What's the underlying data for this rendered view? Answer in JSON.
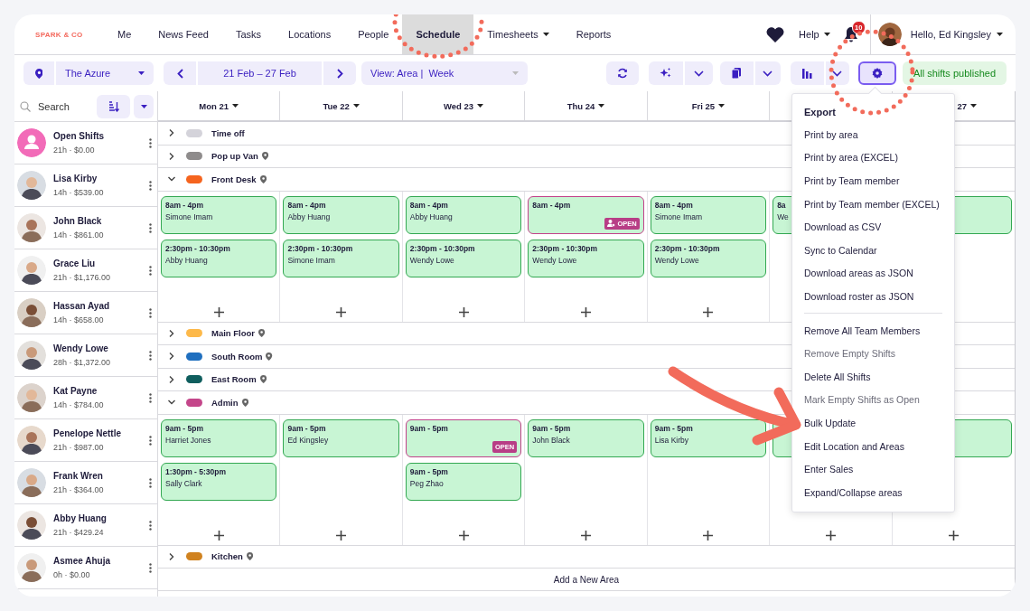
{
  "nav": {
    "logo": "SPARK & CO",
    "items": [
      {
        "label": "Me",
        "selected": false,
        "dropdown": false
      },
      {
        "label": "News Feed",
        "selected": false,
        "dropdown": false
      },
      {
        "label": "Tasks",
        "selected": false,
        "dropdown": false
      },
      {
        "label": "Locations",
        "selected": false,
        "dropdown": false
      },
      {
        "label": "People",
        "selected": false,
        "dropdown": false
      },
      {
        "label": "Schedule",
        "selected": true,
        "dropdown": false
      },
      {
        "label": "Timesheets",
        "selected": false,
        "dropdown": true
      },
      {
        "label": "Reports",
        "selected": false,
        "dropdown": false
      }
    ],
    "help": "Help",
    "notifications": "10",
    "greeting": "Hello, Ed Kingsley"
  },
  "toolbar": {
    "location": "The Azure",
    "date_range": "21 Feb – 27 Feb",
    "view": "View: Area |  Week",
    "status": "All shifts published"
  },
  "sidebar": {
    "search": {
      "placeholder": "Search"
    },
    "people": [
      {
        "name": "Open Shifts",
        "stats": "21h · $0.00",
        "kind": "open"
      },
      {
        "name": "Lisa Kirby",
        "stats": "14h · $539.00",
        "kind": "person"
      },
      {
        "name": "John Black",
        "stats": "14h · $861.00",
        "kind": "person"
      },
      {
        "name": "Grace Liu",
        "stats": "21h · $1,176.00",
        "kind": "person"
      },
      {
        "name": "Hassan Ayad",
        "stats": "14h · $658.00",
        "kind": "person"
      },
      {
        "name": "Wendy Lowe",
        "stats": "28h · $1,372.00",
        "kind": "person"
      },
      {
        "name": "Kat Payne",
        "stats": "14h · $784.00",
        "kind": "person"
      },
      {
        "name": "Penelope Nettle",
        "stats": "21h · $987.00",
        "kind": "person"
      },
      {
        "name": "Frank Wren",
        "stats": "21h · $364.00",
        "kind": "person"
      },
      {
        "name": "Abby Huang",
        "stats": "21h · $429.24",
        "kind": "person"
      },
      {
        "name": "Asmee Ahuja",
        "stats": "0h · $0.00",
        "kind": "person"
      }
    ]
  },
  "days": [
    "Mon 21",
    "Tue 22",
    "Wed 23",
    "Thu 24",
    "Fri 25"
  ],
  "last_day_partial": "27",
  "areas": [
    {
      "name": "Time off",
      "color": "#d4d3da",
      "expanded": false,
      "location_icon": false
    },
    {
      "name": "Pop up Van",
      "color": "#8f8c8c",
      "expanded": false,
      "location_icon": true
    },
    {
      "name": "Front Desk",
      "color": "#f5641e",
      "expanded": true,
      "location_icon": true,
      "days": [
        {
          "add_button": true,
          "shifts": [
            {
              "time": "8am - 4pm",
              "name": "Simone Imam",
              "open": false
            },
            {
              "time": "2:30pm - 10:30pm",
              "name": "Abby Huang",
              "open": false
            }
          ]
        },
        {
          "add_button": true,
          "shifts": [
            {
              "time": "8am - 4pm",
              "name": "Abby Huang",
              "open": false
            },
            {
              "time": "2:30pm - 10:30pm",
              "name": "Simone Imam",
              "open": false
            }
          ]
        },
        {
          "add_button": true,
          "shifts": [
            {
              "time": "8am - 4pm",
              "name": "Abby Huang",
              "open": false
            },
            {
              "time": "2:30pm - 10:30pm",
              "name": "Wendy Lowe",
              "open": false
            }
          ]
        },
        {
          "add_button": true,
          "shifts": [
            {
              "time": "8am - 4pm",
              "open": true,
              "badge": "OPEN",
              "badge_icon": true
            },
            {
              "time": "2:30pm - 10:30pm",
              "name": "Wendy Lowe",
              "open": false
            }
          ]
        },
        {
          "add_button": true,
          "shifts": [
            {
              "time": "8am - 4pm",
              "name": "Simone Imam",
              "open": false
            },
            {
              "time": "2:30pm - 10:30pm",
              "name": "Wendy Lowe",
              "open": false
            }
          ]
        },
        {
          "add_button": false,
          "shifts": [
            {
              "time": "8a",
              "name": "We",
              "open": false
            }
          ]
        },
        {
          "add_button": false,
          "shifts": [
            {
              "open": false
            }
          ]
        }
      ]
    },
    {
      "name": "Main Floor",
      "color": "#fdb94a",
      "expanded": false,
      "location_icon": true
    },
    {
      "name": "South Room",
      "color": "#1f6fbf",
      "expanded": false,
      "location_icon": true
    },
    {
      "name": "East Room",
      "color": "#0f5e5e",
      "expanded": false,
      "location_icon": true
    },
    {
      "name": "Admin",
      "color": "#c4468a",
      "expanded": true,
      "location_icon": true,
      "days": [
        {
          "add_button": true,
          "shifts": [
            {
              "time": "9am - 5pm",
              "name": "Harriet Jones",
              "open": false
            },
            {
              "time": "1:30pm - 5:30pm",
              "name": "Sally Clark",
              "open": false
            }
          ]
        },
        {
          "add_button": true,
          "shifts": [
            {
              "time": "9am - 5pm",
              "name": "Ed Kingsley",
              "open": false
            }
          ]
        },
        {
          "add_button": true,
          "shifts": [
            {
              "time": "9am - 5pm",
              "open": true,
              "badge": "OPEN",
              "badge_icon": false
            },
            {
              "time": "9am - 5pm",
              "name": "Peg Zhao",
              "open": false
            }
          ]
        },
        {
          "add_button": true,
          "shifts": [
            {
              "time": "9am - 5pm",
              "name": "John Black",
              "open": false
            }
          ]
        },
        {
          "add_button": true,
          "shifts": [
            {
              "time": "9am - 5pm",
              "name": "Lisa Kirby",
              "open": false
            }
          ]
        },
        {
          "add_button": true,
          "shifts": [
            {
              "open": false
            }
          ]
        },
        {
          "add_button": true,
          "shifts": [
            {
              "open": false
            }
          ]
        }
      ]
    },
    {
      "name": "Kitchen",
      "color": "#d0821f",
      "expanded": false,
      "location_icon": true
    }
  ],
  "add_area": "Add a New Area",
  "menu": {
    "title": "Export",
    "groups": [
      [
        {
          "label": "Print by area",
          "disabled": false
        },
        {
          "label": "Print by area (EXCEL)",
          "disabled": false
        },
        {
          "label": "Print by Team member",
          "disabled": false
        },
        {
          "label": "Print by Team member (EXCEL)",
          "disabled": false
        },
        {
          "label": "Download as CSV",
          "disabled": false
        },
        {
          "label": "Sync to Calendar",
          "disabled": false
        },
        {
          "label": "Download areas as JSON",
          "disabled": false
        },
        {
          "label": "Download roster as JSON",
          "disabled": false
        }
      ],
      [
        {
          "label": "Remove All Team Members",
          "disabled": false
        },
        {
          "label": "Remove Empty Shifts",
          "disabled": true
        },
        {
          "label": "Delete All Shifts",
          "disabled": false
        },
        {
          "label": "Mark Empty Shifts as Open",
          "disabled": true
        },
        {
          "label": "Bulk Update",
          "disabled": false
        },
        {
          "label": "Edit Location and Areas",
          "disabled": false
        },
        {
          "label": "Enter Sales",
          "disabled": false
        },
        {
          "label": "Expand/Collapse areas",
          "disabled": false
        }
      ]
    ]
  }
}
